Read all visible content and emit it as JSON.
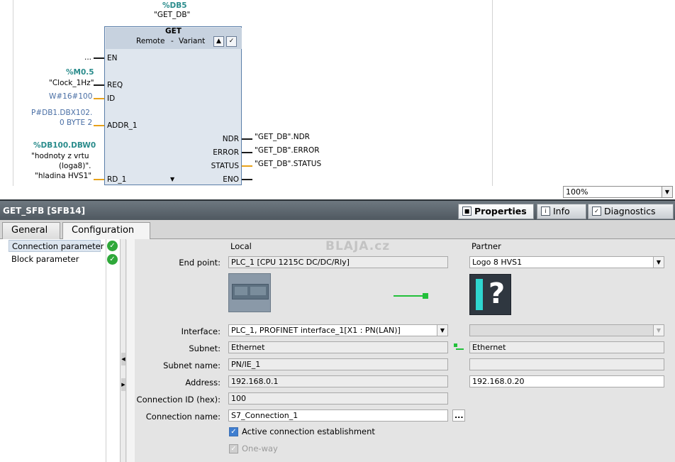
{
  "block": {
    "instance": "%DB5",
    "instance_name": "\"GET_DB\"",
    "type": "GET",
    "variant_label": "Remote",
    "variant_sep": "-",
    "variant_value": "Variant",
    "inputs": {
      "en_value": "...",
      "en_pin": "EN",
      "req_addr": "%M0.5",
      "req_value": "\"Clock_1Hz\"",
      "req_pin": "REQ",
      "id_value": "W#16#100",
      "id_pin": "ID",
      "addr1_line1": "P#DB1.DBX102.",
      "addr1_line2": "0 BYTE 2",
      "addr1_pin": "ADDR_1",
      "rd1_addr": "%DB100.DBW0",
      "rd1_line1": "\"hodnoty z vrtu",
      "rd1_line2": "(loga8)\".",
      "rd1_line3": "\"hladina HVS1\"",
      "rd1_pin": "RD_1"
    },
    "outputs": {
      "ndr_pin": "NDR",
      "ndr_value": "\"GET_DB\".NDR",
      "error_pin": "ERROR",
      "error_value": "\"GET_DB\".ERROR",
      "status_pin": "STATUS",
      "status_value": "\"GET_DB\".STATUS",
      "eno_pin": "ENO"
    }
  },
  "zoom": "100%",
  "inspector": {
    "title": "GET_SFB [SFB14]",
    "tabs": [
      {
        "label": "Properties",
        "icon": "properties-icon"
      },
      {
        "label": "Info",
        "icon": "info-icon"
      },
      {
        "label": "Diagnostics",
        "icon": "diagnostics-icon"
      }
    ],
    "subtabs": [
      "General",
      "Configuration"
    ]
  },
  "tree": {
    "items": [
      {
        "label": "Connection parameter",
        "status": "ok"
      },
      {
        "label": "Block parameter",
        "status": "ok"
      }
    ]
  },
  "form": {
    "col_local": "Local",
    "col_partner": "Partner",
    "watermark": "BLAJA.cz",
    "end_point_label": "End point:",
    "local_end_point": "PLC_1 [CPU 1215C DC/DC/Rly]",
    "partner_end_point": "Logo 8 HVS1",
    "interface_label": "Interface:",
    "local_interface": "PLC_1, PROFINET interface_1[X1 : PN(LAN)]",
    "partner_interface": "",
    "subnet_label": "Subnet:",
    "local_subnet": "Ethernet",
    "partner_subnet": "Ethernet",
    "subnet_name_label": "Subnet name:",
    "local_subnet_name": "PN/IE_1",
    "partner_subnet_name": "",
    "address_label": "Address:",
    "local_address": "192.168.0.1",
    "partner_address": "192.168.0.20",
    "conn_id_label": "Connection ID (hex):",
    "conn_id": "100",
    "conn_name_label": "Connection name:",
    "conn_name": "S7_Connection_1",
    "browse": "...",
    "active_conn_label": "Active connection establishment",
    "active_conn_checked": true,
    "one_way_label": "One-way",
    "one_way_checked": true
  },
  "colors": {
    "accent_teal": "#2a8c8c",
    "ok_green": "#2fa83a",
    "link_green": "#22c03a",
    "wire_orange": "#e8a21a"
  }
}
